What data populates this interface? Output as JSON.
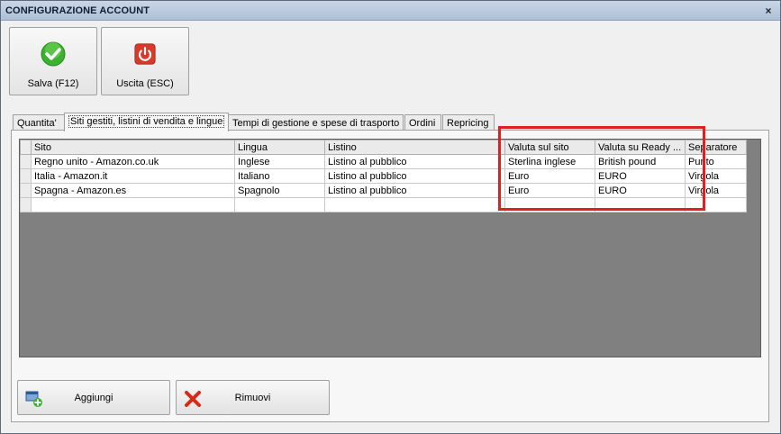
{
  "window": {
    "title": "CONFIGURAZIONE ACCOUNT",
    "close_glyph": "×"
  },
  "toolbar": {
    "save_label": "Salva (F12)",
    "exit_label": "Uscita (ESC)",
    "save_icon": "check-icon",
    "exit_icon": "power-icon",
    "save_color": "#3cb030",
    "exit_color": "#d83a2a"
  },
  "tabs": [
    {
      "label": "Quantita'"
    },
    {
      "label": "Siti gestiti, listini di vendita e lingue"
    },
    {
      "label": "Tempi di gestione e spese di trasporto"
    },
    {
      "label": "Ordini"
    },
    {
      "label": "Repricing"
    }
  ],
  "grid": {
    "columns": [
      "Sito",
      "Lingua",
      "Listino",
      "Valuta sul sito",
      "Valuta su Ready ...",
      "Separatore"
    ],
    "rows": [
      [
        "Regno unito - Amazon.co.uk",
        "Inglese",
        "Listino al pubblico",
        "Sterlina inglese",
        "British pound",
        "Punto"
      ],
      [
        "Italia - Amazon.it",
        "Italiano",
        "Listino al pubblico",
        "Euro",
        "EURO",
        "Virgola"
      ],
      [
        "Spagna - Amazon.es",
        "Spagnolo",
        "Listino al pubblico",
        "Euro",
        "EURO",
        "Virgola"
      ],
      [
        "",
        "",
        "",
        "",
        "",
        ""
      ]
    ],
    "highlight_color": "#e02020"
  },
  "actions": {
    "add_label": "Aggiungi",
    "remove_label": "Rimuovi",
    "add_icon": "add-window-icon",
    "remove_icon": "red-x-icon"
  }
}
